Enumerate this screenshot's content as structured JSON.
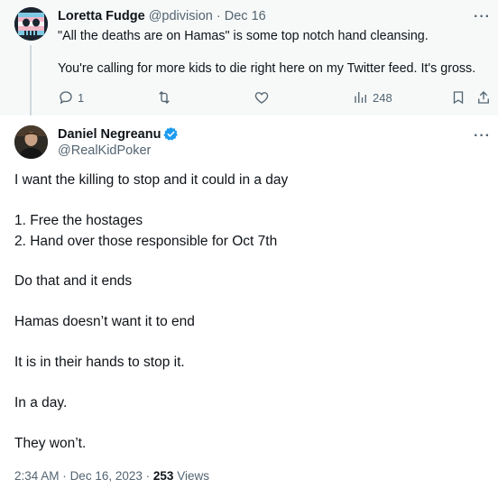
{
  "reply_tweet": {
    "author_name": "Loretta Fudge",
    "handle": "@pdivision",
    "separator": "·",
    "date": "Dec 16",
    "text_line1": "\"All the deaths are on Hamas\" is some top notch hand cleansing.",
    "text_line2": "You're calling for more kids to die right here on my Twitter feed. It's gross.",
    "actions": {
      "reply_count": "1",
      "views_count": "248"
    },
    "icons": [
      "more-icon",
      "reply-icon",
      "retweet-icon",
      "like-icon",
      "views-icon",
      "bookmark-icon",
      "share-icon"
    ]
  },
  "main_tweet": {
    "author_name": "Daniel Negreanu",
    "handle": "@RealKidPoker",
    "verified_color": "#1d9bf0",
    "lines": [
      "I want the killing to stop and it could in a day",
      "1. Free the hostages",
      "2. Hand over those responsible for Oct 7th",
      "Do that and it ends",
      "Hamas doesn’t want it to end",
      "It is in their hands to stop it.",
      "In a day.",
      "They won’t."
    ],
    "time": "2:34 AM",
    "dot": "·",
    "date": "Dec 16, 2023",
    "views_count": "253",
    "views_label": "Views"
  },
  "colors": {
    "reply_background": "#f7f9f9",
    "text_primary": "#0f1419",
    "text_secondary": "#536471",
    "thread_line": "#cfd9de"
  }
}
